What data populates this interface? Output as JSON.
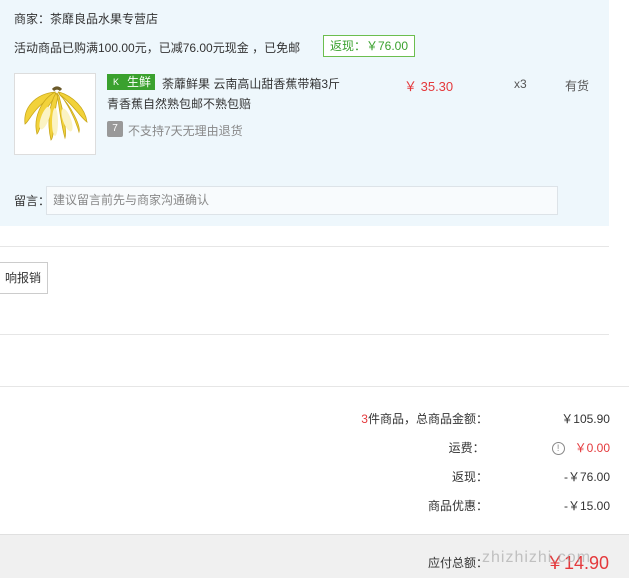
{
  "shop": {
    "label": "商家：",
    "name": "茶靡良品水果专营店",
    "promo_text": "活动商品已购满100.00元，已减76.00元现金 ，已免邮",
    "rebate_tag": "返现：￥76.00"
  },
  "item": {
    "badge_icon": "K",
    "badge_label": "生鲜",
    "title_line1": "荼蘼鲜果 云南高山甜香蕉带箱3斤",
    "title_line2": "青香蕉自然熟包邮不熟包赔",
    "no_return_icon": "7",
    "no_return_text": "不支持7天无理由退货",
    "price": "￥ 35.30",
    "qty": "x3",
    "stock": "有货"
  },
  "remark": {
    "label": "留言：",
    "placeholder": "建议留言前先与商家沟通确认"
  },
  "invoice": {
    "button_label": "响报销"
  },
  "summary": {
    "count": "3",
    "count_suffix": "件商品，总商品金额：",
    "goods_total": "￥105.90",
    "shipping_label": "运费：",
    "shipping_value": "￥0.00",
    "rebate_label": "返现：",
    "rebate_value": "-￥76.00",
    "discount_label": "商品优惠：",
    "discount_value": "-￥15.00"
  },
  "footer": {
    "total_label": "应付总额：",
    "total_value": "￥14.90"
  },
  "watermark": "zhizhizhi.com",
  "colors": {
    "accent_red": "#e4393c",
    "fresh_green": "#3aa12e",
    "shop_bg": "#eef7fc"
  }
}
